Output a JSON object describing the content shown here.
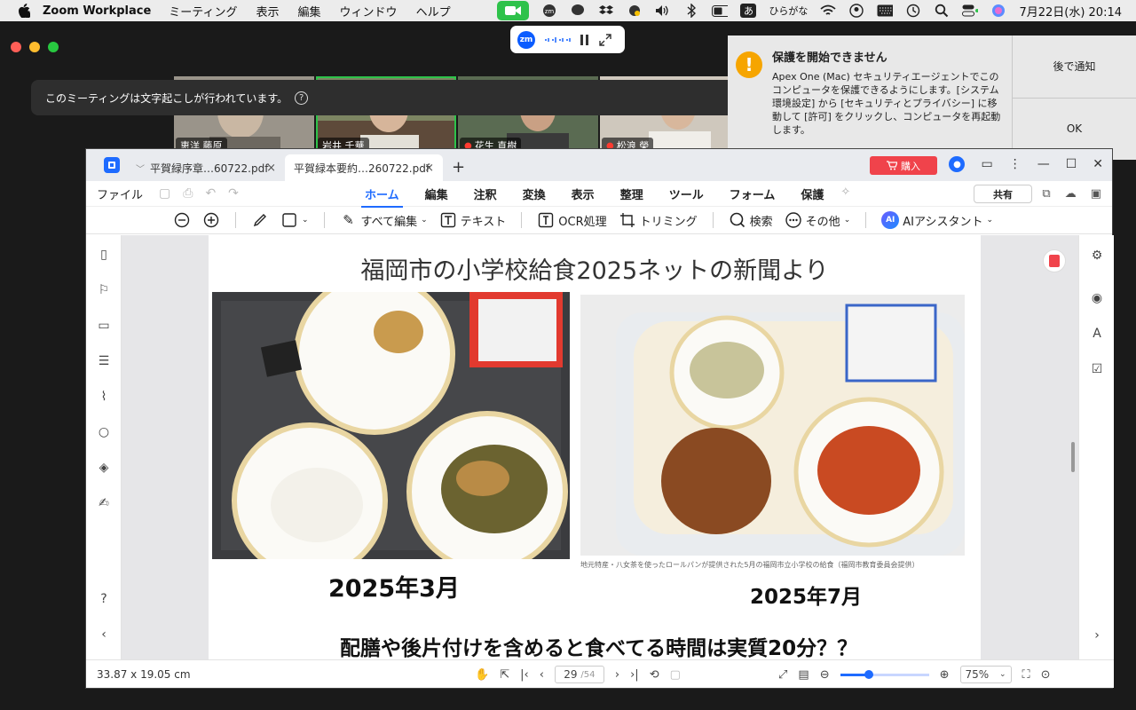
{
  "menubar": {
    "app_name": "Zoom Workplace",
    "items": [
      "ミーティング",
      "表示",
      "編集",
      "ウィンドウ",
      "ヘルプ"
    ],
    "ime_label": "あ",
    "ime_text": "ひらがな",
    "datetime": "7月22日(水)  20:14"
  },
  "zoom": {
    "mini_badge": "zm",
    "caption_notice": "このミーティングは文字起こしが行われています。",
    "participants": [
      {
        "name": "恵洋 藤原",
        "muted": false,
        "bg": "#8a8a86"
      },
      {
        "name": "岩井 千華",
        "muted": false,
        "bg": "#6f7a5c"
      },
      {
        "name": "花生 直樹",
        "muted": true,
        "bg": "#5a6b52"
      },
      {
        "name": "松浪 榮",
        "muted": true,
        "bg": "#b9b3a8"
      }
    ]
  },
  "notification": {
    "title": "保護を開始できません",
    "body": "Apex One (Mac) セキュリティエージェントでこのコンピュータを保護できるようにします。[システム環境設定] から [セキュリティとプライバシー] に移動して [許可] をクリックし、コンピュータを再起動します。",
    "later": "後で通知",
    "ok": "OK"
  },
  "pdf": {
    "tabs": [
      {
        "label": "平賀緑序章…60722.pdf",
        "active": false
      },
      {
        "label": "平賀緑本要約…260722.pdf",
        "active": true
      }
    ],
    "buy": "購入",
    "file_menu": "ファイル",
    "menu_tabs": [
      "ホーム",
      "編集",
      "注釈",
      "変換",
      "表示",
      "整理",
      "ツール",
      "フォーム",
      "保護"
    ],
    "share": "共有",
    "tools": {
      "edit_all": "すべて編集",
      "text": "テキスト",
      "ocr": "OCR処理",
      "crop": "トリミング",
      "search": "検索",
      "more": "その他",
      "ai": "AIアシスタント",
      "ai_badge": "AI"
    },
    "page": {
      "title": "福岡市の小学校給食2025ネットの新聞より",
      "date_left": "2025年3月",
      "date_right": "2025年7月",
      "photo_caption": "地元特産・八女茶を使ったロールパンが提供された5月の福岡市立小学校の給食（福岡市教育委員会提供）",
      "headline": "配膳や後片付けを含めると食べてる時間は実質20分？？"
    },
    "status": {
      "dimensions": "33.87 x 19.05 cm",
      "current_page": "29",
      "total_pages": "/54",
      "zoom": "75%",
      "zoom_fraction": 0.32
    }
  }
}
